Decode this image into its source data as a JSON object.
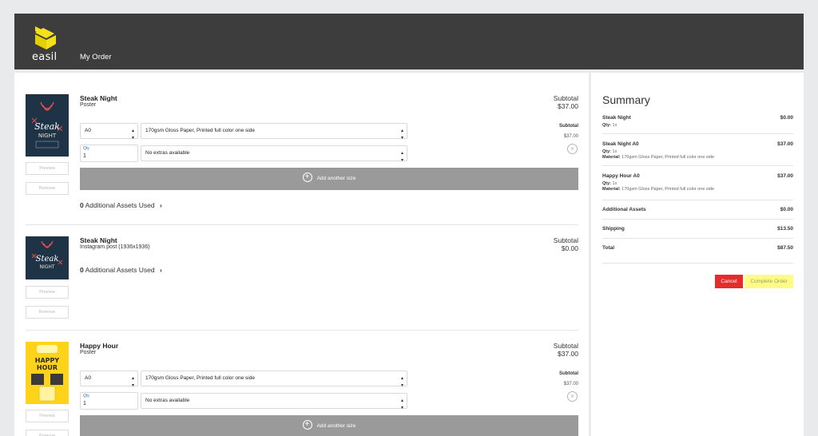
{
  "header": {
    "logo_text": "easil",
    "title": "My Order"
  },
  "items": [
    {
      "name": "Steak Night",
      "type": "Poster",
      "subtotal_label": "Subtotal",
      "subtotal": "$37.00",
      "size": "A0",
      "material": "170gsm Gloss Paper, Printed full color one side",
      "qty_label": "Qty",
      "qty": "1",
      "extras": "No extras available",
      "line_subtotal_label": "Subtotal",
      "line_subtotal": "$37.00",
      "add_size_label": "Add another size",
      "assets_count": "0",
      "assets_label": "Additional Assets Used",
      "preview_label": "Preview",
      "remove_label": "Remove",
      "thumb_text": [
        "Steak",
        "NIGHT"
      ]
    },
    {
      "name": "Steak Night",
      "type": "Instagram post (1936x1936)",
      "subtotal_label": "Subtotal",
      "subtotal": "$0.00",
      "assets_count": "0",
      "assets_label": "Additional Assets Used",
      "preview_label": "Preview",
      "remove_label": "Remove",
      "thumb_text": [
        "Steak",
        "NIGHT"
      ]
    },
    {
      "name": "Happy Hour",
      "type": "Poster",
      "subtotal_label": "Subtotal",
      "subtotal": "$37.00",
      "size": "A0",
      "material": "170gsm Gloss Paper, Printed full color one side",
      "qty_label": "Qty",
      "qty": "1",
      "extras": "No extras available",
      "line_subtotal_label": "Subtotal",
      "line_subtotal": "$37.00",
      "add_size_label": "Add another size",
      "preview_label": "Preview",
      "remove_label": "Remove",
      "thumb_text": [
        "HAPPY",
        "HOUR"
      ]
    }
  ],
  "summary": {
    "title": "Summary",
    "rows": [
      {
        "name": "Steak Night",
        "amount": "$0.00",
        "qty_label": "Qty:",
        "qty": "1x"
      },
      {
        "name": "Steak Night A0",
        "amount": "$37.00",
        "qty_label": "Qty:",
        "qty": "1x",
        "material_label": "Material:",
        "material": "170gsm Gloss Paper, Printed full color one side"
      },
      {
        "name": "Happy Hour A0",
        "amount": "$37.00",
        "qty_label": "Qty:",
        "qty": "1x",
        "material_label": "Material:",
        "material": "170gsm Gloss Paper, Printed full color one side"
      }
    ],
    "additional_assets": {
      "label": "Additional Assets",
      "amount": "$0.00"
    },
    "shipping": {
      "label": "Shipping",
      "amount": "$13.50"
    },
    "total": {
      "label": "Total",
      "amount": "$87.50"
    },
    "cancel_label": "Cancel",
    "complete_label": "Complete Order"
  },
  "colors": {
    "header_bg": "#3d3d3e",
    "logo_yellow": "#f5e11a",
    "cancel": "#e62b2b",
    "complete": "#fffb85",
    "add_size_bg": "#9a9a9a"
  }
}
